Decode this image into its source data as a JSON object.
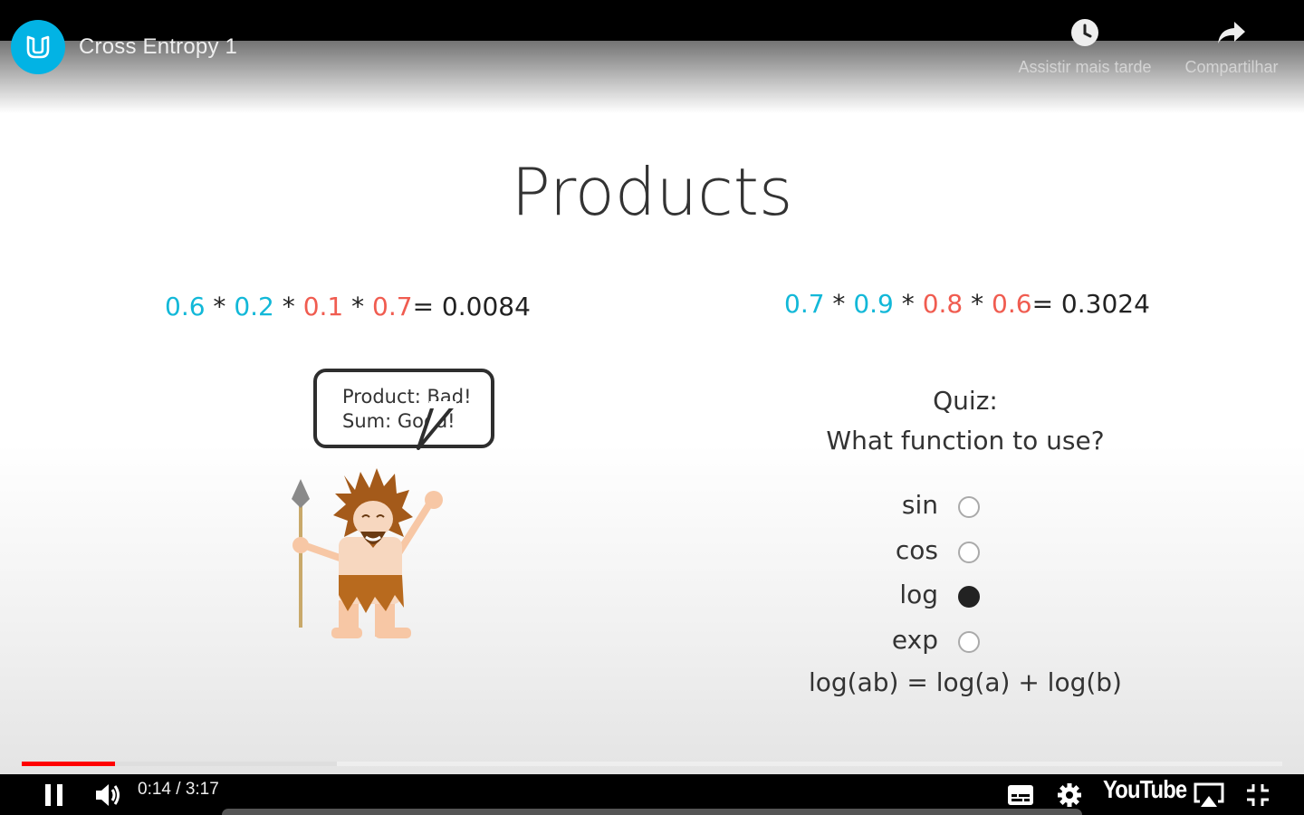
{
  "player": {
    "video_title": "Cross Entropy 1",
    "watch_later_label": "Assistir mais tarde",
    "share_label": "Compartilhar",
    "time_display": "0:14 / 3:17",
    "progress_played": 0.074,
    "progress_buffered": 0.25,
    "brand": "YouTube",
    "icons": {
      "channel": "udacity-logo-icon",
      "watch_later": "clock-icon",
      "share": "share-arrow-icon",
      "play_pause": "pause-icon",
      "volume": "volume-icon",
      "captions": "captions-icon",
      "settings": "gear-icon",
      "airplay": "airplay-icon",
      "fullscreen": "exit-fullscreen-icon"
    },
    "colors": {
      "accent": "#ff0000",
      "brand": "#02b3e4"
    }
  },
  "slide": {
    "title": "Products",
    "equation_left": [
      {
        "t": "0.6",
        "c": "blue"
      },
      {
        "t": " * ",
        "c": "dark"
      },
      {
        "t": "0.2",
        "c": "blue"
      },
      {
        "t": " * ",
        "c": "dark"
      },
      {
        "t": "0.1",
        "c": "red"
      },
      {
        "t": " * ",
        "c": "dark"
      },
      {
        "t": "0.7",
        "c": "red"
      },
      {
        "t": "= 0.0084",
        "c": "dark"
      }
    ],
    "equation_right": [
      {
        "t": "0.7",
        "c": "blue"
      },
      {
        "t": " * ",
        "c": "dark"
      },
      {
        "t": "0.9",
        "c": "blue"
      },
      {
        "t": " * ",
        "c": "dark"
      },
      {
        "t": "0.8",
        "c": "red"
      },
      {
        "t": " * ",
        "c": "dark"
      },
      {
        "t": "0.6",
        "c": "red"
      },
      {
        "t": "= 0.3024",
        "c": "dark"
      }
    ],
    "bubble_line1": "Product: Bad!",
    "bubble_line2": "Sum: Good!",
    "quiz_label": "Quiz:",
    "quiz_question": "What function to use?",
    "options": [
      {
        "label": "sin",
        "selected": false
      },
      {
        "label": "cos",
        "selected": false
      },
      {
        "label": "log",
        "selected": true
      },
      {
        "label": "exp",
        "selected": false
      }
    ],
    "identity": "log(ab) = log(a) + log(b)"
  }
}
